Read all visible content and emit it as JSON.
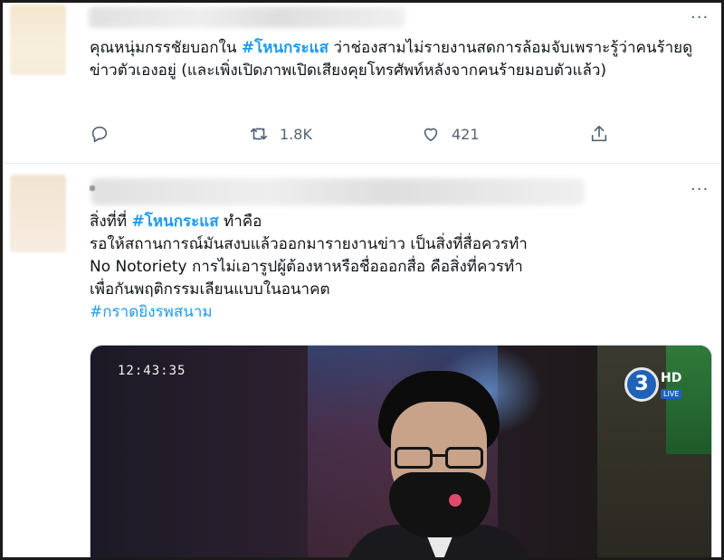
{
  "tweet1": {
    "more": "···",
    "text_before": "คุณหนุ่มกรรชัยบอกใน ",
    "hashtag": "#โหนกระแส",
    "text_after": " ว่าช่องสามไม่รายงานสดการล้อมจับเพราะรู้ว่าคนร้ายดูข่าวตัวเองอยู่ (และเพิ่งเปิดภาพเปิดเสียงคุยโทรศัพท์หลังจากคนร้ายมอบตัวแล้ว)",
    "actions": {
      "reply_icon": "reply-icon",
      "retweet_icon": "retweet-icon",
      "retweet_count": "1.8K",
      "like_icon": "heart-icon",
      "like_count": "421",
      "share_icon": "share-icon"
    }
  },
  "tweet2": {
    "more": "···",
    "line1_before": "สิ่งที่ที่ ",
    "line1_hashtag": "#โหนกระแส",
    "line1_after": " ทำคือ",
    "line2": "รอให้สถานการณ์มันสงบแล้วออกมารายงานข่าว เป็นสิ่งที่สื่อควรทำ",
    "line3": "No Notoriety การไม่เอารูปผู้ต้องหาหรือชื่อออกสื่อ คือสิ่งที่ควรทำ",
    "line4": "เพื่อกันพฤติกรรมเลียนแบบในอนาคต",
    "hashtag2": "#กราดยิงรพสนาม",
    "media": {
      "timecode": "12:43:35",
      "channel_number": "3",
      "channel_hd": "HD",
      "channel_live": "LIVE"
    }
  },
  "colors": {
    "hashtag": "#1d9bf0",
    "icon_gray": "#536471",
    "divider": "#e6ecf0"
  }
}
